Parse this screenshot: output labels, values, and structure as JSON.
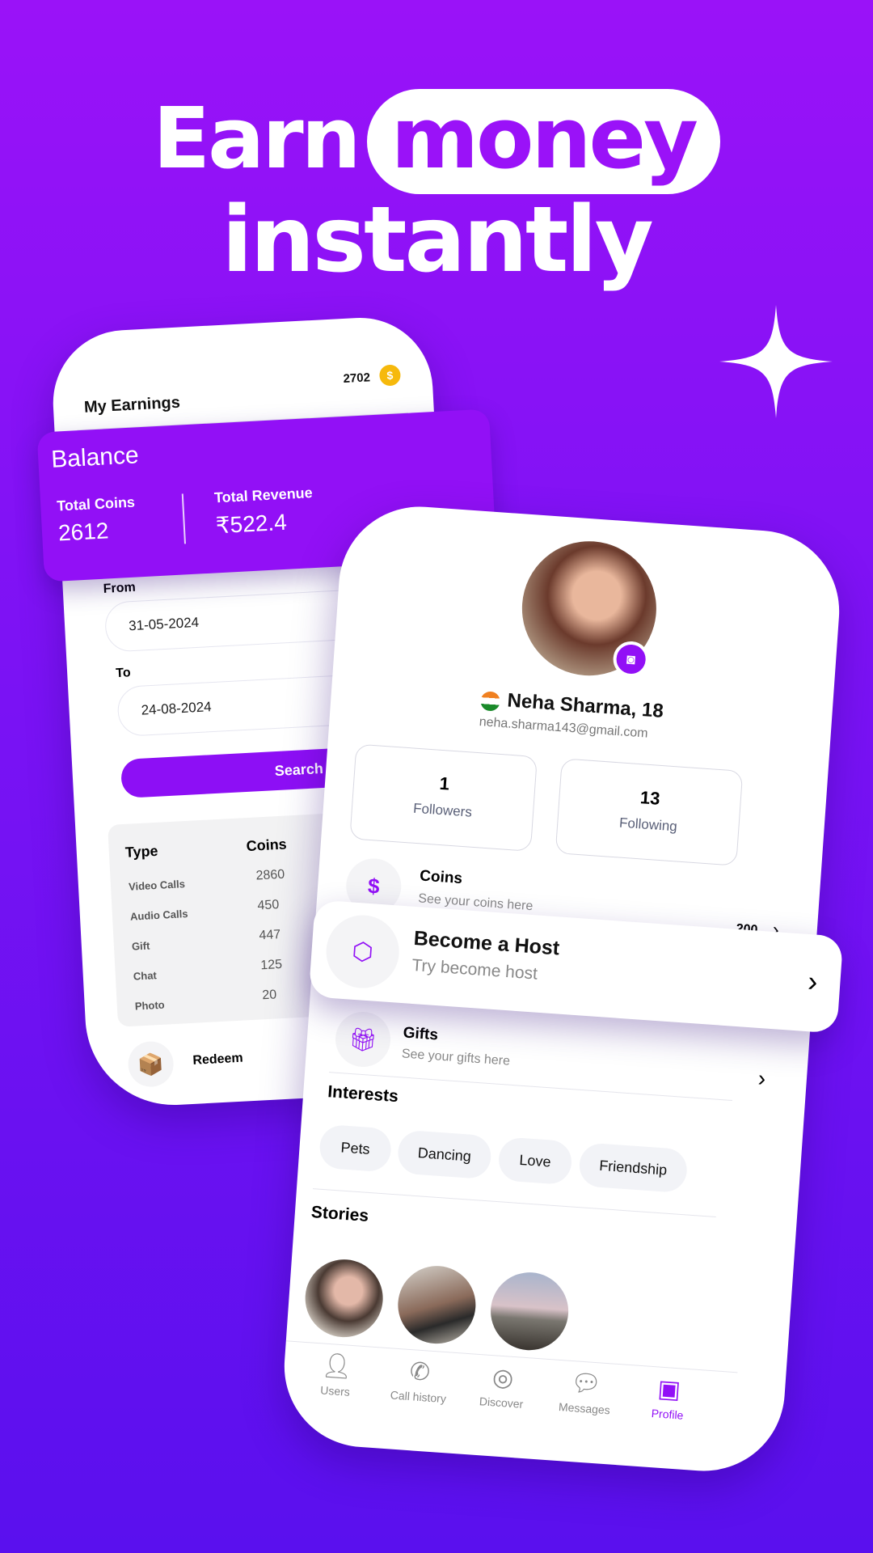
{
  "headline": {
    "line1_word1": "Earn",
    "line1_highlight": "money",
    "line2": "instantly"
  },
  "colors": {
    "brand": "#9210f6",
    "background_top": "#9a12f8",
    "background_bottom": "#5a10ee"
  },
  "earnings": {
    "title": "My Earnings",
    "coin_balance": "2702",
    "coin_icon": "gold-coin-icon",
    "balance": {
      "title": "Balance",
      "total_coins_label": "Total Coins",
      "total_coins": "2612",
      "total_revenue_label": "Total Revenue",
      "total_revenue": "₹522.4"
    },
    "from_label": "From",
    "from_value": "31-05-2024",
    "to_label": "To",
    "to_value": "24-08-2024",
    "search_label": "Search",
    "table": {
      "headers": [
        "Type",
        "Coins"
      ],
      "rows": [
        [
          "Video Calls",
          "2860"
        ],
        [
          "Audio Calls",
          "450"
        ],
        [
          "Gift",
          "447"
        ],
        [
          "Chat",
          "125"
        ],
        [
          "Photo",
          "20"
        ]
      ]
    },
    "redeem_label": "Redeem"
  },
  "profile": {
    "name": "Neha Sharma, 18",
    "email": "neha.sharma143@gmail.com",
    "flag": "india-flag-icon",
    "followers": {
      "count": "1",
      "label": "Followers"
    },
    "following": {
      "count": "13",
      "label": "Following"
    },
    "coins": {
      "title": "Coins",
      "subtitle": "See your coins here",
      "value": "200"
    },
    "host": {
      "title": "Become a Host",
      "subtitle": "Try become host"
    },
    "gifts": {
      "title": "Gifts",
      "subtitle": "See your gifts here"
    },
    "interests_title": "Interests",
    "interests": [
      "Pets",
      "Dancing",
      "Love",
      "Friendship"
    ],
    "stories_title": "Stories",
    "nav": [
      {
        "label": "Users",
        "icon": "user-icon"
      },
      {
        "label": "Call history",
        "icon": "phone-icon"
      },
      {
        "label": "Discover",
        "icon": "compass-icon"
      },
      {
        "label": "Messages",
        "icon": "chat-bubble-icon"
      },
      {
        "label": "Profile",
        "icon": "profile-icon",
        "active": true
      }
    ]
  }
}
